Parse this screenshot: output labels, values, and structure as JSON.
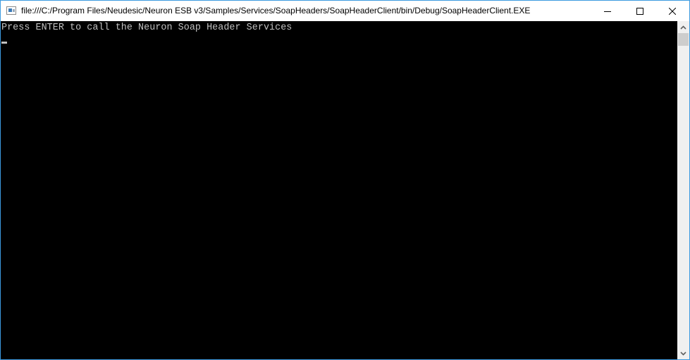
{
  "window": {
    "title": "file:///C:/Program Files/Neudesic/Neuron ESB v3/Samples/Services/SoapHeaders/SoapHeaderClient/bin/Debug/SoapHeaderClient.EXE",
    "icon": "console-app-icon",
    "controls": {
      "minimize": "minimize-icon",
      "maximize": "maximize-icon",
      "close": "close-icon"
    }
  },
  "console": {
    "lines": [
      "Press ENTER to call the Neuron Soap Header Services"
    ],
    "background": "#000000",
    "foreground": "#c0c0c0",
    "cursor": "underscore"
  },
  "scrollbar": {
    "up_icon": "chevron-up-icon",
    "down_icon": "chevron-down-icon"
  },
  "colors": {
    "window_border": "#3c9ae0"
  }
}
